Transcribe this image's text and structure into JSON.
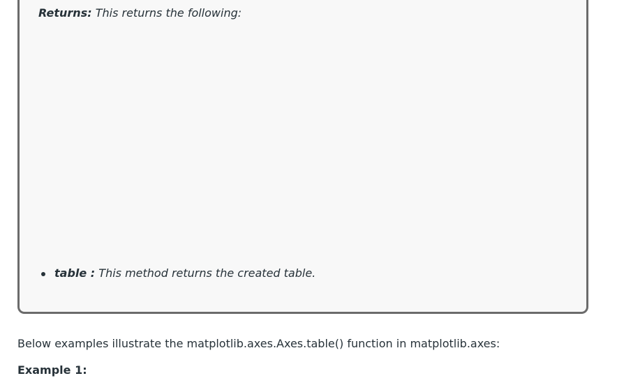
{
  "returns_box": {
    "label": "Returns:",
    "text": " This returns the following:",
    "items": [
      {
        "term": "table :",
        "description": " This method returns the created table."
      }
    ]
  },
  "body": {
    "paragraph": "Below examples illustrate the matplotlib.axes.Axes.table() function in matplotlib.axes:",
    "example_heading": "Example 1:"
  },
  "colors": {
    "text": "#273239",
    "box_background": "#f8f8f8",
    "box_border": "#6b6b6b"
  }
}
